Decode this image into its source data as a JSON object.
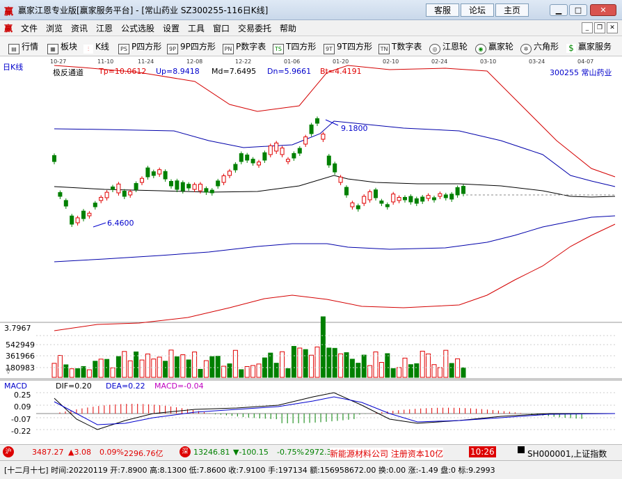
{
  "window": {
    "title": "赢家江恩专业版[赢家服务平台] - [常山药业  SZ300255-116日K线]",
    "nav": [
      "客服",
      "论坛",
      "主页"
    ]
  },
  "menu": [
    "文件",
    "浏览",
    "资讯",
    "江恩",
    "公式选股",
    "设置",
    "工具",
    "窗口",
    "交易委托",
    "帮助"
  ],
  "toolbar": [
    "行情",
    "板块",
    "K线",
    "P四方形",
    "9P四方形",
    "P数字表",
    "T四方形",
    "9T四方形",
    "T数字表",
    "江恩轮",
    "赢家轮",
    "六角形",
    "赢家服务"
  ],
  "chart": {
    "period_label": "日K线",
    "indicator_name": "极反通道",
    "tp": "Tp=10.0612",
    "up": "Up=8.9418",
    "md": "Md=7.6495",
    "dn": "Dn=5.9661",
    "bt": "Bt=4.4191",
    "stock": "300255  常山药业",
    "dates": [
      "10-27",
      "11-10",
      "11-24",
      "12-08",
      "12-22",
      "01-06",
      "01-20",
      "02-10",
      "02-24",
      "03-10",
      "03-24",
      "04-07"
    ],
    "high_label": "9.1800",
    "low_label": "6.4600",
    "colors": {
      "up": "#e00000",
      "down": "#008000",
      "tp": "#d40000",
      "up_line": "#0000aa",
      "md": "#000000",
      "bg": "#ffffff"
    }
  },
  "volume": {
    "labels": [
      "3.7967",
      "542949",
      "361966",
      "180983"
    ]
  },
  "macd": {
    "name": "MACD",
    "dif": "DIF=0.20",
    "dea": "DEA=0.22",
    "macd": "MACD=-0.04",
    "labels": [
      "0.25",
      "0.09",
      "-0.07",
      "-0.22"
    ]
  },
  "status1": {
    "sh_index": "3487.27",
    "sh_change": "▲3.08",
    "sh_pct": "0.09%",
    "sh_amount": "2296.76亿",
    "sz_index": "13246.81",
    "sz_change": "▼-100.15",
    "sz_pct": "-0.75%",
    "sz_amount": "2972.3",
    "news": "新能源材料公司 注册资本10亿",
    "time": "10:26",
    "index_code": "SH000001,上证指数"
  },
  "status2": {
    "info": "[十二月十七] 时间:20220119 开:7.8900 高:8.1300 低:7.8600 收:7.9100 手:197134 额:156958672.00 换:0.00 涨:-1.49 盘:0 标:9.2993"
  }
}
